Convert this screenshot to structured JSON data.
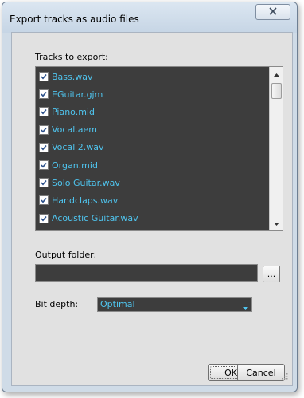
{
  "window": {
    "title": "Export tracks as audio files"
  },
  "tracks": {
    "label": "Tracks to export:",
    "items": [
      {
        "name": "Bass.wav",
        "checked": true
      },
      {
        "name": "EGuitar.gjm",
        "checked": true
      },
      {
        "name": "Piano.mid",
        "checked": true
      },
      {
        "name": "Vocal.aem",
        "checked": true
      },
      {
        "name": "Vocal 2.wav",
        "checked": true
      },
      {
        "name": "Organ.mid",
        "checked": true
      },
      {
        "name": "Solo Guitar.wav",
        "checked": true
      },
      {
        "name": "Handclaps.wav",
        "checked": true
      },
      {
        "name": "Acoustic Guitar.wav",
        "checked": true
      }
    ]
  },
  "output": {
    "label": "Output folder:",
    "value": "",
    "browse_label": "..."
  },
  "bit_depth": {
    "label": "Bit depth:",
    "selected": "Optimal"
  },
  "buttons": {
    "ok": "OK",
    "cancel": "Cancel"
  },
  "colors": {
    "list_bg": "#3d3d3d",
    "item_text": "#4fc4ee",
    "dialog_bg": "#e1e1e1",
    "frame": "#cfdbe7"
  }
}
